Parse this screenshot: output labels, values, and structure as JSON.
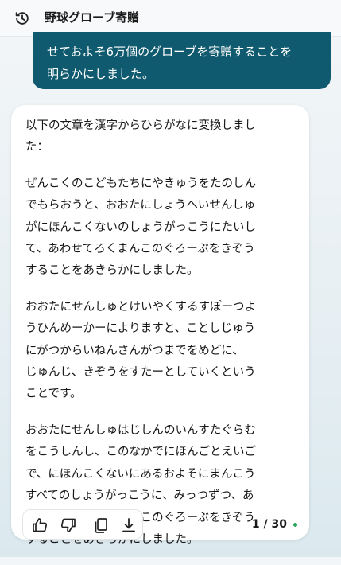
{
  "header": {
    "title": "野球グローブ寄贈",
    "history_icon": "history-icon"
  },
  "user_message": {
    "lines": [
      "せておよそ6万個のグローブを寄贈することを",
      "明らかにしました。"
    ]
  },
  "ai_message": {
    "paragraphs": [
      {
        "lines": [
          "以下の文章を漢字からひらがなに変換しまし",
          "た："
        ]
      },
      {
        "lines": [
          "ぜんこくのこどもたちにやきゅうをたのしん",
          "でもらおうと、おおたにしょうへいせんしゅ",
          "がにほんこくないのしょうがっこうにたいし",
          "て、あわせてろくまんこのぐろーぶをきぞう",
          "することをあきらかにしました。"
        ]
      },
      {
        "lines": [
          "おおたにせんしゅとけいやくするすぽーつよ",
          "うひんめーかーによりますと、ことしじゅう",
          "にがつからいねんさんがつまでをめどに、",
          "じゅんじ、きぞうをすたーとしていくという",
          "ことです。"
        ]
      },
      {
        "lines": [
          "おおたにせんしゅはじしんのいんすたぐらむ",
          "をこうしんし、このなかでにほんごとえいご",
          "で、にほんこくないにあるおよそにまんこう",
          "すべてのしょうがっこうに、みっつずつ、あ",
          "わせておよそろくまんこのぐろーぶをきぞう",
          "することをあきらかにしました。"
        ]
      }
    ]
  },
  "actions": {
    "icons": [
      "thumbs-up-icon",
      "thumbs-down-icon",
      "copy-icon",
      "download-icon"
    ]
  },
  "pagination": {
    "label": "1 / 30"
  },
  "colors": {
    "user_bubble": "#0f5a6e",
    "status_dot": "#2aa55a"
  }
}
